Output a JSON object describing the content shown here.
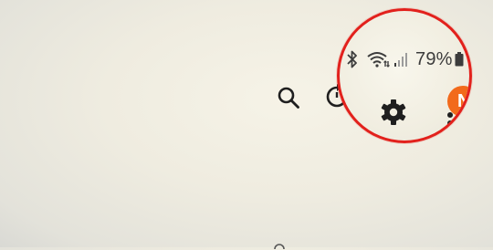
{
  "toolbar": {
    "icons": [
      "search-icon",
      "history-icon"
    ]
  },
  "magnifier_callout": {
    "border_color": "#e2211c",
    "status_bar": {
      "icons": [
        "bluetooth-icon",
        "wifi-icon",
        "cellular-signal-icon",
        "battery-icon"
      ],
      "battery_percent": "79%"
    },
    "settings_icon": "gear-icon",
    "avatar": {
      "initial": "N",
      "color": "#f26a1b"
    },
    "overflow_icon": "more-vert-icon"
  }
}
